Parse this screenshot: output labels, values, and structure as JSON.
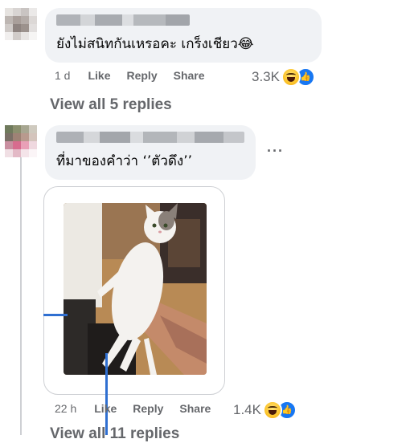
{
  "comments": [
    {
      "text": "ยังไม่สนิทกันเหรอคะ เกร็งเชียว😂",
      "time": "1 d",
      "like": "Like",
      "reply": "Reply",
      "share": "Share",
      "reaction_count": "3.3K",
      "reaction_icons": [
        "haha-icon",
        "like-icon"
      ],
      "view_replies": "View all 5 replies"
    },
    {
      "text": "ที่มาของคำว่า ‘’ตัวดึง’’",
      "more": "···",
      "time": "22 h",
      "like": "Like",
      "reply": "Reply",
      "share": "Share",
      "reaction_count": "1.4K",
      "reaction_icons": [
        "haha-icon",
        "like-icon"
      ],
      "view_replies": "View all 11 replies"
    }
  ],
  "colors": {
    "bubble": "#f0f2f5",
    "meta_text": "#65676b",
    "like_blue": "#1877f2",
    "haha_yellow": "#fcc52c"
  }
}
